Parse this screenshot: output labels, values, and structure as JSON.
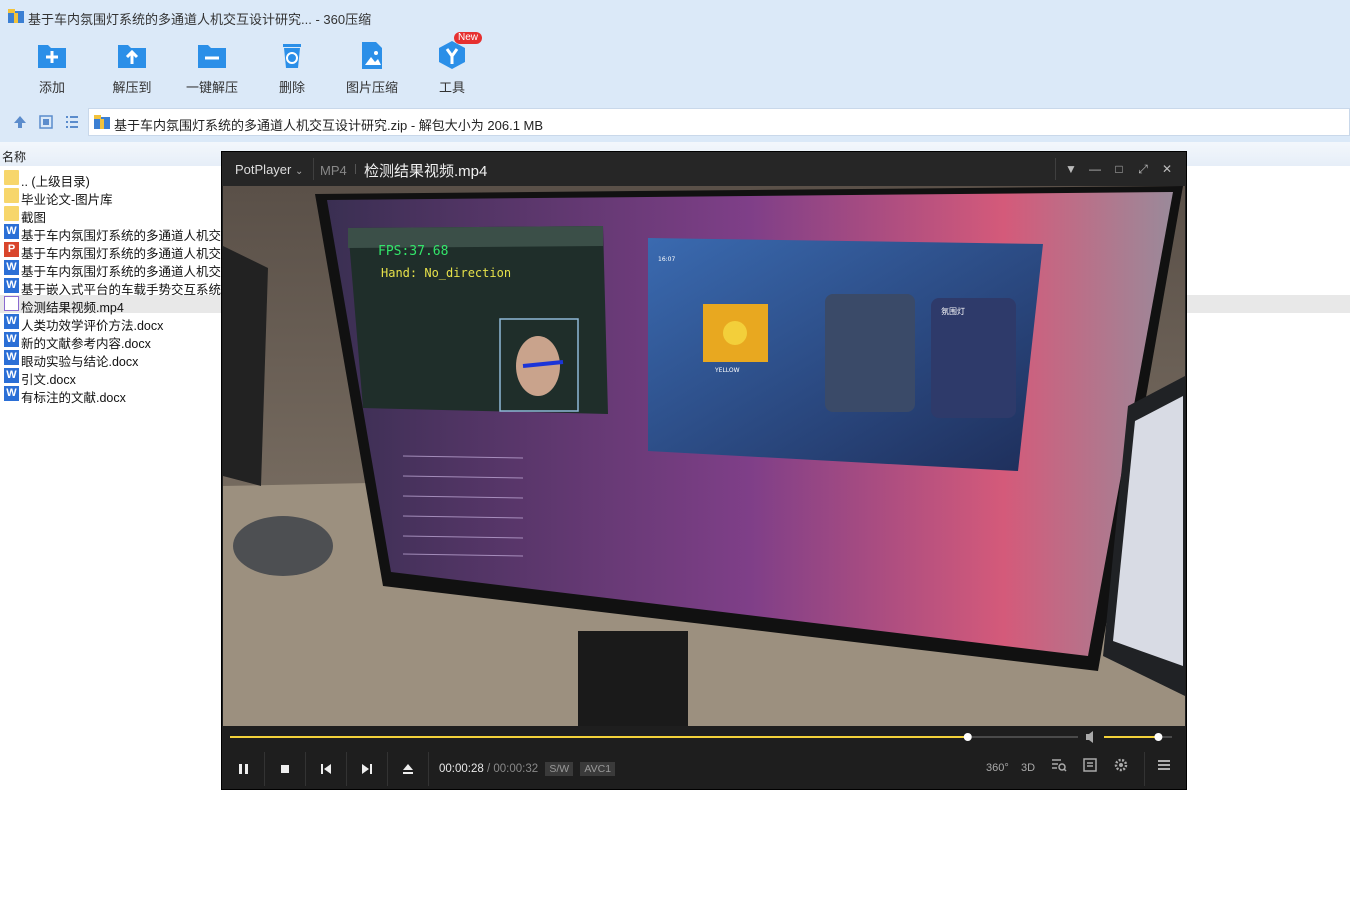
{
  "window": {
    "title": "基于车内氛围灯系统的多通道人机交互设计研究... - 360压缩"
  },
  "toolbar": {
    "add": "添加",
    "extract_to": "解压到",
    "one_click_extract": "一键解压",
    "delete": "删除",
    "image_compress": "图片压缩",
    "tools": "工具",
    "new_badge": "New"
  },
  "address": {
    "path": "基于车内氛围灯系统的多通道人机交互设计研究.zip - 解包大小为 206.1 MB"
  },
  "list": {
    "column_name": "名称",
    "files": [
      {
        "name": ".. (上级目录)",
        "icon": "folder-icon"
      },
      {
        "name": "毕业论文-图片库",
        "icon": "folder-icon"
      },
      {
        "name": "截图",
        "icon": "folder-icon"
      },
      {
        "name": "基于车内氛围灯系统的多通道人机交互",
        "icon": "word-icon"
      },
      {
        "name": "基于车内氛围灯系统的多通道人机交互",
        "icon": "ppt-icon"
      },
      {
        "name": "基于车内氛围灯系统的多通道人机交互",
        "icon": "word-icon"
      },
      {
        "name": "基于嵌入式平台的车载手势交互系统研",
        "icon": "word-icon"
      },
      {
        "name": "检测结果视频.mp4",
        "icon": "mp4-icon"
      },
      {
        "name": "人类功效学评价方法.docx",
        "icon": "word-icon"
      },
      {
        "name": "新的文献参考内容.docx",
        "icon": "word-icon"
      },
      {
        "name": "眼动实验与结论.docx",
        "icon": "word-icon"
      },
      {
        "name": "引文.docx",
        "icon": "word-icon"
      },
      {
        "name": "有标注的文献.docx",
        "icon": "word-icon"
      }
    ]
  },
  "player": {
    "brand": "PotPlayer",
    "format": "MP4",
    "file": "检测结果视频.mp4",
    "elapsed": "00:00:28",
    "separator": "/",
    "total": "00:00:32",
    "tag_sw": "S/W",
    "tag_codec": "AVC1",
    "progress": 0.87,
    "volume": 0.8,
    "icon_360": "360°",
    "icon_3d": "3D",
    "video_overlay": {
      "fps": "FPS:37.68",
      "hand": "Hand: No_direction",
      "album": "YELLOW",
      "panel": "氛围灯",
      "time": "16:07"
    }
  },
  "colors": {
    "accent_blue": "#2b8fe8",
    "seek_yellow": "#f3d23a",
    "toolbar_bg": "#dbe9f8"
  }
}
